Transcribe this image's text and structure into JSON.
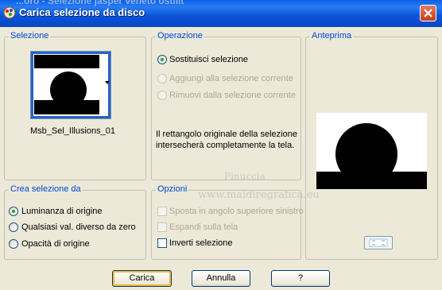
{
  "window": {
    "background_caption": "...oro - Selezione jasper veneto ostilit",
    "title": "Carica selezione da disco"
  },
  "selezione": {
    "group_label": "Selezione",
    "file_name": "Msb_Sel_Illusions_01"
  },
  "operazione": {
    "group_label": "Operazione",
    "options": [
      {
        "label": "Sostituisci selezione",
        "checked": true,
        "enabled": true
      },
      {
        "label": "Aggiungi alla selezione corrente",
        "checked": false,
        "enabled": false
      },
      {
        "label": "Rimuovi dalla selezione corrente",
        "checked": false,
        "enabled": false
      }
    ],
    "info_text": "Il rettangolo originale della selezione intersecherà completamente la tela."
  },
  "anteprima": {
    "group_label": "Anteprima"
  },
  "crea": {
    "group_label": "Crea selezione da",
    "options": [
      {
        "label": "Luminanza di origine",
        "checked": true
      },
      {
        "label": "Qualsiasi val. diverso da zero",
        "checked": false
      },
      {
        "label": "Opacità di origine",
        "checked": false
      }
    ]
  },
  "opzioni": {
    "group_label": "Opzioni",
    "items": [
      {
        "label": "Sposta in angolo superiore sinistro",
        "checked": false,
        "enabled": false
      },
      {
        "label": "Espandi sulla tela",
        "checked": false,
        "enabled": false
      },
      {
        "label": "Inverti selezione",
        "checked": false,
        "enabled": true
      }
    ]
  },
  "watermark": {
    "line1": "Pinuccia",
    "line2": "www.maidiregrafica.eu"
  },
  "buttons": {
    "load": "Carica",
    "cancel": "Annulla",
    "help": "?"
  },
  "icons": {
    "app": "paint-shop-pro-icon",
    "close": "close-icon",
    "dropdown": "chevron-down-icon",
    "zoom": "zoom-toggle-icon"
  },
  "colors": {
    "titlebar": "#0a5fe6",
    "group_label": "#0046d5",
    "dialog_bg": "#ece9d8"
  }
}
